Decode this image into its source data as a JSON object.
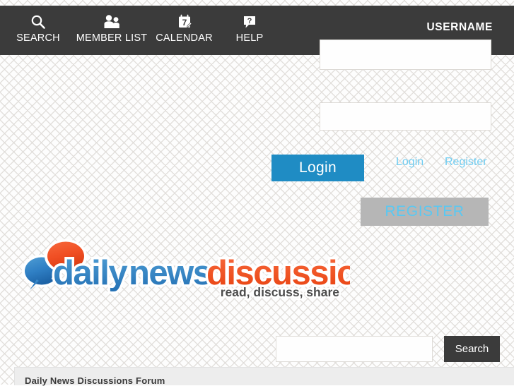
{
  "nav": {
    "items": [
      {
        "id": "search",
        "label": "SEARCH",
        "icon": "search-icon"
      },
      {
        "id": "memberlist",
        "label": "MEMBER LIST",
        "icon": "users-icon"
      },
      {
        "id": "calendar",
        "label": "CALENDAR",
        "icon": "calendar-icon"
      },
      {
        "id": "help",
        "label": "HELP",
        "icon": "question-bubble-icon"
      }
    ],
    "username_label": "USERNAME",
    "background_color": "#3b3b3b"
  },
  "login": {
    "username_value": "",
    "username_placeholder": "",
    "password_value": "",
    "password_placeholder": "",
    "submit_label": "Login",
    "submit_color": "#1f8cc4",
    "link_login": "Login",
    "link_register": "Register",
    "link_color": "#6fcdf2",
    "register_label": "REGISTER",
    "register_bg": "#b6b6b6",
    "register_text_color": "#59c8f2"
  },
  "logo": {
    "word_one": "daily",
    "word_two": "news",
    "word_three": "discussions",
    "tagline": "read, discuss, share",
    "blue": "#2f7fc4",
    "orange": "#f04e23",
    "tagline_color": "#4d4d4d"
  },
  "forum_search": {
    "value": "",
    "placeholder": "",
    "button_label": "Search",
    "button_color": "#3b3b3b"
  },
  "forum_panel": {
    "title": "Daily News Discussions Forum",
    "background": "#ededed"
  }
}
